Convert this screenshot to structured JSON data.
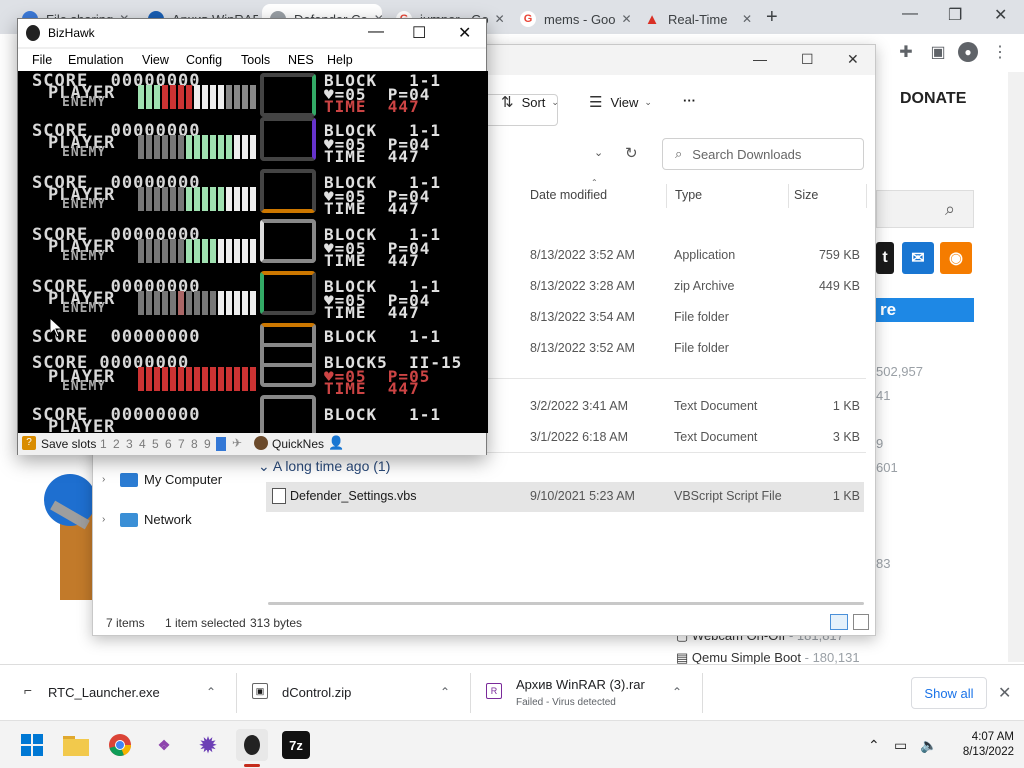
{
  "browser": {
    "tabs": [
      {
        "label": "File sharing",
        "icon": "file-sharing-favicon",
        "color": "#3c7ad9"
      },
      {
        "label": "Архив WinRAR",
        "icon": "winrar-favicon",
        "color": "#1a5fb4"
      },
      {
        "label": "Defender Co",
        "icon": "defender-favicon",
        "color": "#9aa0a6"
      },
      {
        "label": "jumper - Go",
        "icon": "google-favicon",
        "color": "#ea4335"
      },
      {
        "label": "mems - Goo",
        "icon": "google-favicon",
        "color": "#ea4335"
      },
      {
        "label": "Real-Time",
        "icon": "warning-favicon",
        "color": "#d93025"
      }
    ],
    "new_tab": "+",
    "window_controls": {
      "minimize": "—",
      "maximize": "❐",
      "close": "✕"
    }
  },
  "webpage": {
    "donate": "DONATE",
    "banner_text": "re",
    "numbers": [
      "502,957",
      "41",
      "9",
      "601",
      "83"
    ],
    "links": [
      {
        "label": "Webcam On-Off",
        "sub": " - 181,817"
      },
      {
        "label": "Qemu Simple Boot",
        "sub": " - 180,131"
      }
    ],
    "colors": {
      "twitter": "#1a1a1a",
      "mail": "#1976d2",
      "rss": "#f57c00",
      "banner": "#1e88e5"
    }
  },
  "explorer": {
    "commands": {
      "sort": "Sort",
      "view": "View",
      "more": "···"
    },
    "search_placeholder": "Search Downloads",
    "columns": {
      "date": "Date modified",
      "type": "Type",
      "size": "Size"
    },
    "rows": [
      {
        "name": "",
        "date": "8/13/2022 3:52 AM",
        "type": "Application",
        "size": "759 KB"
      },
      {
        "name": "",
        "date": "8/13/2022 3:28 AM",
        "type": "zip Archive",
        "size": "449 KB"
      },
      {
        "name": "",
        "date": "8/13/2022 3:54 AM",
        "type": "File folder",
        "size": ""
      },
      {
        "name": "",
        "date": "8/13/2022 3:52 AM",
        "type": "File folder",
        "size": ""
      },
      {
        "name": "",
        "date": "3/2/2022 3:41 AM",
        "type": "Text Document",
        "size": "1 KB"
      },
      {
        "name": "",
        "date": "3/1/2022 6:18 AM",
        "type": "Text Document",
        "size": "3 KB"
      }
    ],
    "group_label": "A long time ago (1)",
    "selected_row": {
      "name": "Defender_Settings.vbs",
      "date": "9/10/2021 5:23 AM",
      "type": "VBScript Script File",
      "size": "1 KB"
    },
    "nav": [
      {
        "label": "My Computer",
        "icon": "computer-icon"
      },
      {
        "label": "Network",
        "icon": "network-icon"
      }
    ],
    "status": {
      "items": "7 items",
      "selected": "1 item selected",
      "bytes": "313 bytes"
    }
  },
  "bizhawk": {
    "title": "BizHawk",
    "menu": [
      "File",
      "Emulation",
      "View",
      "Config",
      "Tools",
      "NES",
      "Help"
    ],
    "status": {
      "save_slots_label": "Save slots",
      "slots": [
        "1",
        "2",
        "3",
        "4",
        "5",
        "6",
        "7",
        "8",
        "9",
        "0"
      ],
      "core": "QuickNes"
    },
    "screen_lines": [
      {
        "left": "SCORE  00000000",
        "right": "BLOCK   1-1"
      },
      {
        "left": "PLAYER",
        "right": "♥=05  P=04"
      },
      {
        "left": "ENEMY",
        "right": "TIME  447"
      },
      {
        "left": "SCORE  00000000",
        "right": "BLOCK   1-1"
      },
      {
        "left": "PLAYER",
        "right": "♥=05  P=04"
      },
      {
        "left": "ENEMY",
        "right": "TIME  447"
      },
      {
        "left": "SCORE  00000000",
        "right": "BLOCK   1-1"
      },
      {
        "left": "PLAYER",
        "right": "♥=05  P=04"
      },
      {
        "left": "ENEMY",
        "right": "TIME  447"
      },
      {
        "left": "SCORE  00000000",
        "right": "BLOCK   1-1"
      },
      {
        "left": "PLAYER",
        "right": "♥=05  P=04"
      },
      {
        "left": "ENEMY",
        "right": "TIME  447"
      },
      {
        "left": "SCORE  00000000",
        "right": "BLOCK   1-1"
      },
      {
        "left": "PLAYER",
        "right": "♥=05  P=04"
      },
      {
        "left": "ENEMY",
        "right": "TIME  447"
      },
      {
        "left": "SCORE  00000000",
        "right": "BLOCK   1-1"
      },
      {
        "left": "SCORE 00000000",
        "right": "BLOCK5  II-15"
      },
      {
        "left": "PLAYER",
        "right": "♥=05  P=05"
      },
      {
        "left": "ENEMY",
        "right": "TIME  447"
      },
      {
        "left": "SCORE  00000000",
        "right": "BLOCK   1-1"
      },
      {
        "left": "PLAYER",
        "right": ""
      }
    ]
  },
  "downloads": [
    {
      "name": "RTC_Launcher.exe",
      "sub": ""
    },
    {
      "name": "dControl.zip",
      "sub": ""
    },
    {
      "name": "Архив WinRAR (3).rar",
      "sub": "Failed - Virus detected"
    }
  ],
  "downloads_show_all": "Show all",
  "taskbar": {
    "apps": [
      {
        "name": "start-button",
        "color": "#0078d4"
      },
      {
        "name": "file-explorer",
        "color": "#f2c94c"
      },
      {
        "name": "chrome",
        "color": "#34a853"
      },
      {
        "name": "app-purple-1",
        "color": "#8e44ad"
      },
      {
        "name": "app-purple-2",
        "color": "#6c3fb5"
      },
      {
        "name": "bizhawk",
        "color": "#222222"
      },
      {
        "name": "7zip",
        "color": "#111111"
      }
    ],
    "seven_zip_label": "7z",
    "time": "4:07 AM",
    "date": "8/13/2022"
  }
}
